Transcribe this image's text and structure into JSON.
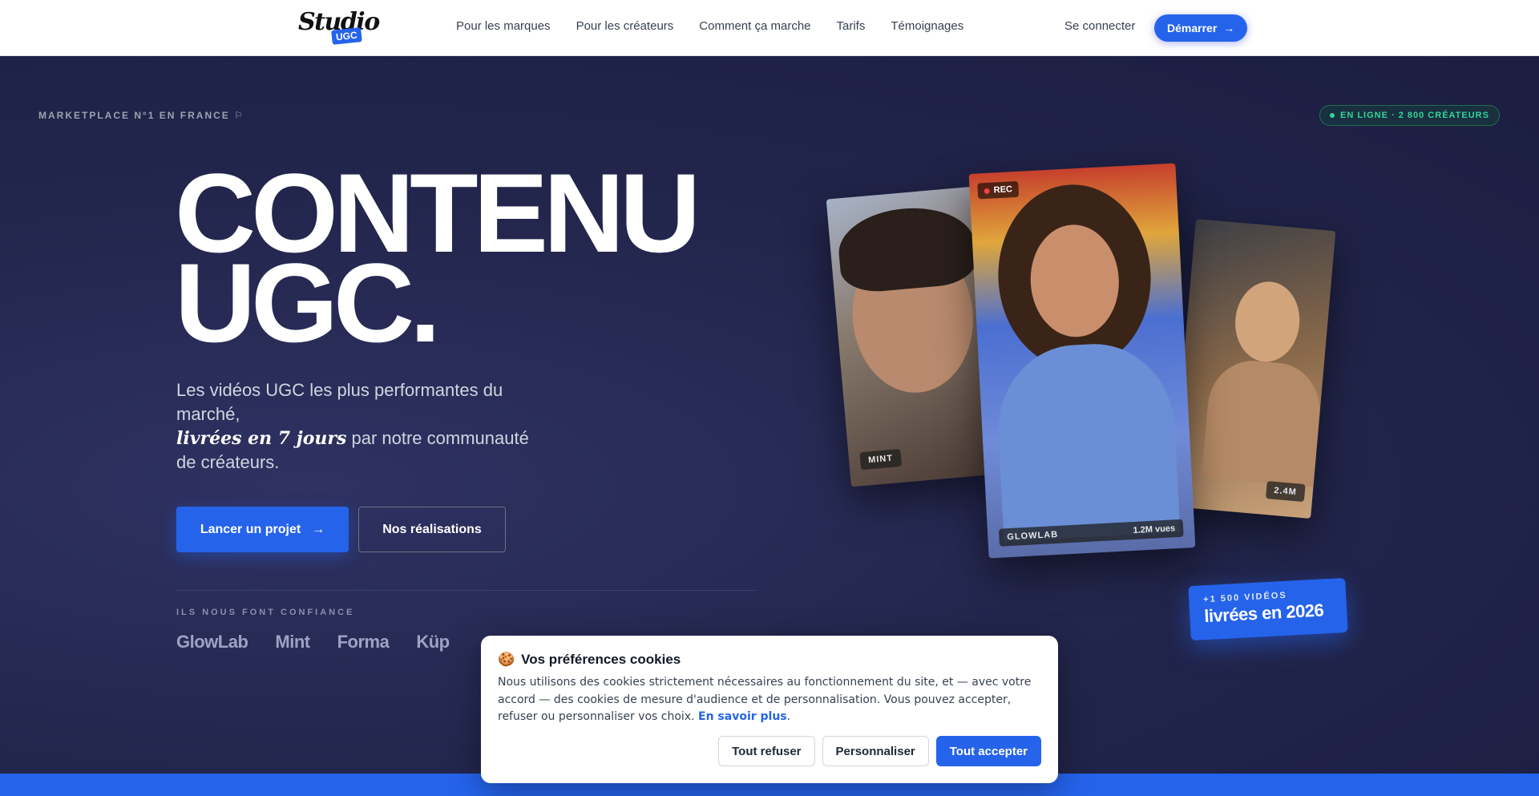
{
  "nav": {
    "logo_text": "Studio",
    "logo_badge": "UGC",
    "links": [
      "Pour les marques",
      "Pour les créateurs",
      "Comment ça marche",
      "Tarifs",
      "Témoignages"
    ],
    "login": "Se connecter",
    "cta": "Démarrer"
  },
  "hero": {
    "eyebrow": "MARKETPLACE N°1 EN FRANCE",
    "online": "EN LIGNE · 2 800 CRÉATEURS",
    "headline_1": "CONTENU",
    "headline_2": "UGC.",
    "sub_1": "Les vidéos UGC les plus performantes du marché,",
    "sub_em": "livrées en 7 jours",
    "sub_2": "par notre communauté de créateurs.",
    "btn_primary": "Lancer un projet",
    "btn_secondary": "Nos réalisations",
    "trust_label": "ILS NOUS FONT CONFIANCE",
    "brands": [
      "GlowLab",
      "Mint",
      "Forma",
      "Küp"
    ]
  },
  "cards": {
    "left_label": "MINT",
    "mid_rec": "REC",
    "mid_brand": "GLOWLAB",
    "mid_views": "1.2M vues",
    "right_views": "2.4M"
  },
  "badge": {
    "small": "+1 500 VIDÉOS",
    "big": "livrées en 2026"
  },
  "cookie": {
    "title": "Vos préférences cookies",
    "body": "Nous utilisons des cookies strictement nécessaires au fonctionnement du site, et — avec votre accord — des cookies de mesure d'audience et de personnalisation. Vous pouvez accepter, refuser ou personnaliser vos choix.",
    "link": "En savoir plus",
    "refuse": "Tout refuser",
    "customize": "Personnaliser",
    "accept": "Tout accepter"
  },
  "colors": {
    "accent": "#2563eb",
    "hero_bg": "#23264d",
    "online": "#34d399"
  }
}
